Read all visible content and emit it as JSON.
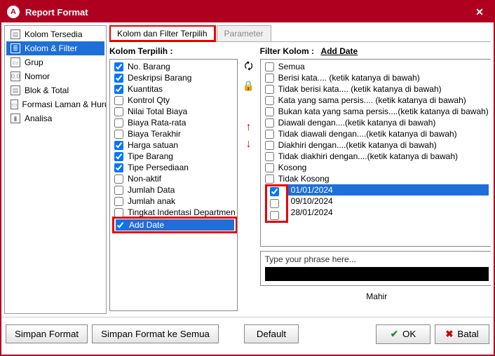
{
  "window": {
    "title": "Report Format"
  },
  "sidebar": {
    "items": [
      {
        "label": "Kolom Tersedia"
      },
      {
        "label": "Kolom & Filter"
      },
      {
        "label": "Grup"
      },
      {
        "label": "Nomor"
      },
      {
        "label": "Blok & Total"
      },
      {
        "label": "Formasi Laman & Huruf"
      },
      {
        "label": "Analisa"
      }
    ]
  },
  "tabs": {
    "tab0": "Kolom dan Filter Terpilih",
    "tab1": "Parameter"
  },
  "leftPanel": {
    "title": "Kolom Terpilih :"
  },
  "kolom": [
    {
      "label": "No. Barang",
      "checked": true
    },
    {
      "label": "Deskripsi Barang",
      "checked": true
    },
    {
      "label": "Kuantitas",
      "checked": true
    },
    {
      "label": "Kontrol Qty",
      "checked": false
    },
    {
      "label": "Nilai Total Biaya",
      "checked": false
    },
    {
      "label": "Biaya Rata-rata",
      "checked": false
    },
    {
      "label": "Biaya Terakhir",
      "checked": false
    },
    {
      "label": "Harga satuan",
      "checked": true
    },
    {
      "label": "Tipe Barang",
      "checked": true
    },
    {
      "label": "Tipe Persediaan",
      "checked": true
    },
    {
      "label": "Non-aktif",
      "checked": false
    },
    {
      "label": "Jumlah Data",
      "checked": false
    },
    {
      "label": "Jumlah anak",
      "checked": false
    },
    {
      "label": "Tingkat Indentasi Departmen",
      "checked": false
    },
    {
      "label": "Add Date",
      "checked": true
    }
  ],
  "rightPanel": {
    "title": "Filter Kolom :",
    "link": "Add Date"
  },
  "filters": [
    {
      "label": "Semua",
      "checked": false
    },
    {
      "label": "Berisi kata.... (ketik katanya di bawah)",
      "checked": false
    },
    {
      "label": "Tidak berisi kata.... (ketik katanya di bawah)",
      "checked": false
    },
    {
      "label": "Kata yang sama persis.... (ketik katanya di bawah)",
      "checked": false
    },
    {
      "label": "Bukan kata yang sama persis....(ketik katanya di bawah)",
      "checked": false
    },
    {
      "label": "Diawali dengan....(ketik katanya di bawah)",
      "checked": false
    },
    {
      "label": "Tidak diawali dengan....(ketik katanya di bawah)",
      "checked": false
    },
    {
      "label": "Diakhiri dengan....(ketik katanya di bawah)",
      "checked": false
    },
    {
      "label": "Tidak diakhiri dengan....(ketik katanya di bawah)",
      "checked": false
    },
    {
      "label": "Kosong",
      "checked": false
    },
    {
      "label": "Tidak Kosong",
      "checked": false
    },
    {
      "label": "01/01/2024",
      "checked": true,
      "selected": true
    },
    {
      "label": "09/10/2024",
      "checked": false
    },
    {
      "label": "28/01/2024",
      "checked": false
    }
  ],
  "phrase": {
    "label": "Type your phrase here..."
  },
  "mahir": "Mahir",
  "buttons": {
    "save": "Simpan Format",
    "saveAll": "Simpan Format ke Semua",
    "default": "Default",
    "ok": "OK",
    "cancel": "Batal"
  }
}
